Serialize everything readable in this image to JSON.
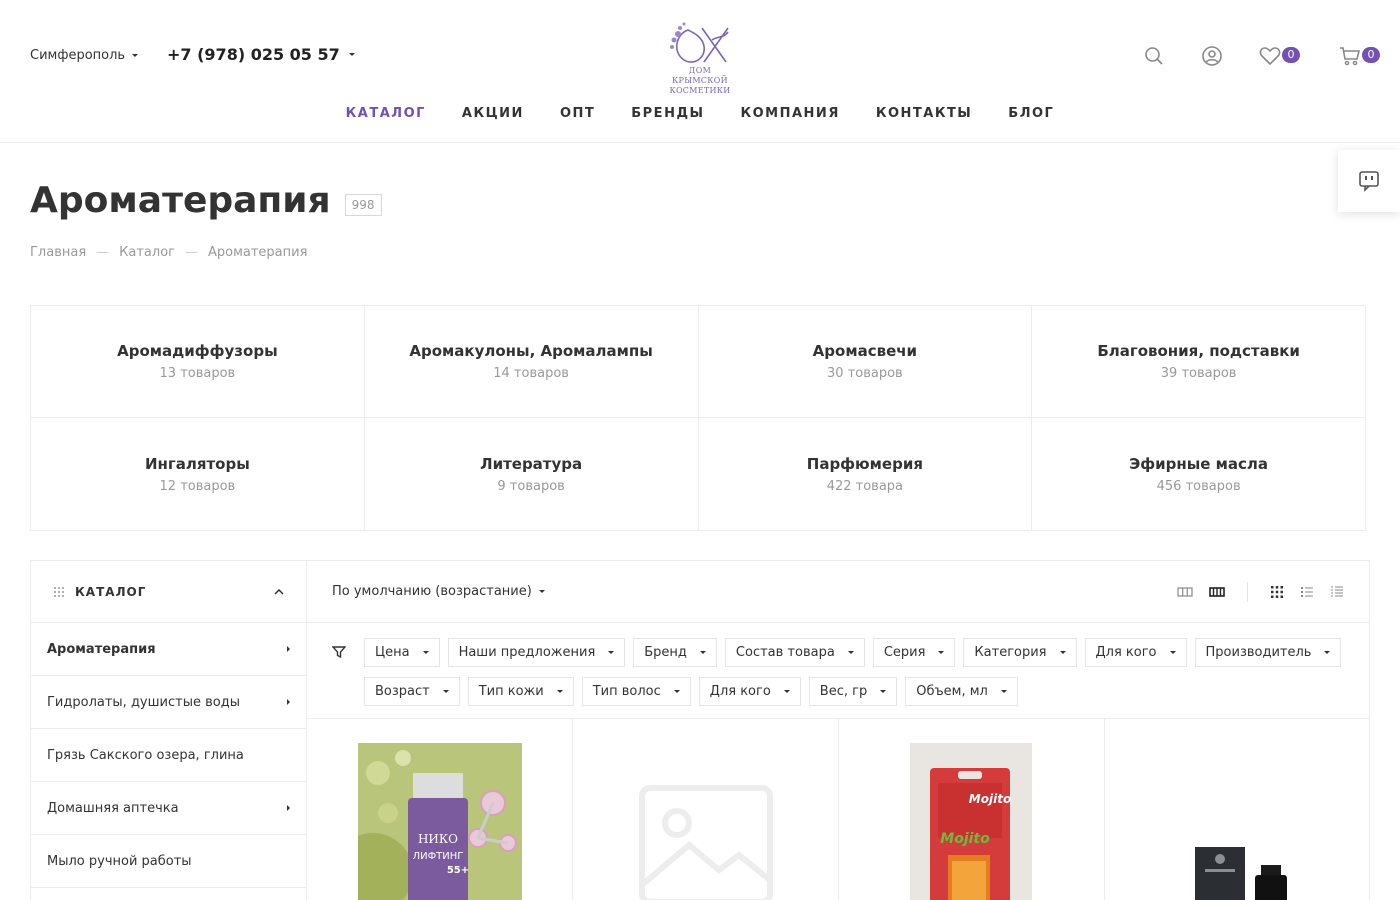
{
  "header": {
    "city": "Симферополь",
    "phone": "+7 (978) 025 05 57",
    "logo_text": "ДОМ КРЫМСКОЙ КОСМЕТИКИ",
    "favorites_count": "0",
    "cart_count": "0"
  },
  "nav": [
    {
      "label": "КАТАЛОГ",
      "active": true
    },
    {
      "label": "АКЦИИ"
    },
    {
      "label": "ОПТ"
    },
    {
      "label": "БРЕНДЫ"
    },
    {
      "label": "КОМПАНИЯ"
    },
    {
      "label": "КОНТАКТЫ"
    },
    {
      "label": "БЛОГ"
    }
  ],
  "page": {
    "title": "Ароматерапия",
    "count": "998"
  },
  "breadcrumb": [
    "Главная",
    "Каталог",
    "Ароматерапия"
  ],
  "breadcrumb_sep": "—",
  "categories": [
    {
      "name": "Аромадиффузоры",
      "count": "13 товаров"
    },
    {
      "name": "Аромакулоны, Аромалампы",
      "count": "14 товаров"
    },
    {
      "name": "Аромасвечи",
      "count": "30 товаров"
    },
    {
      "name": "Благовония, подставки",
      "count": "39 товаров"
    },
    {
      "name": "Ингаляторы",
      "count": "12 товаров"
    },
    {
      "name": "Литература",
      "count": "9 товаров"
    },
    {
      "name": "Парфюмерия",
      "count": "422 товара"
    },
    {
      "name": "Эфирные масла",
      "count": "456 товаров"
    }
  ],
  "sidebar": {
    "title": "КАТАЛОГ",
    "items": [
      {
        "label": "Ароматерапия"
      },
      {
        "label": "Гидролаты, душистые воды"
      },
      {
        "label": "Грязь Сакского озера, глина"
      },
      {
        "label": "Домашняя аптечка"
      },
      {
        "label": "Мыло ручной работы"
      }
    ]
  },
  "sort": {
    "label": "По умолчанию (возрастание)"
  },
  "filters": [
    "Цена",
    "Наши предложения",
    "Бренд",
    "Состав товара",
    "Серия",
    "Категория",
    "Для кого",
    "Производитель",
    "Возраст",
    "Тип кожи",
    "Тип волос",
    "Для кого",
    "Вес, гр",
    "Объем, мл"
  ],
  "product_images": {
    "p1_brand": "НИКО",
    "p1_name": "ЛИФТИНГ",
    "p1_num": "55+",
    "p3_text": "Mojito",
    "p3_text2": "Mojito"
  },
  "colors": {
    "accent": "#7251b5",
    "text": "#333333",
    "muted": "#999999",
    "border": "#ececec"
  }
}
